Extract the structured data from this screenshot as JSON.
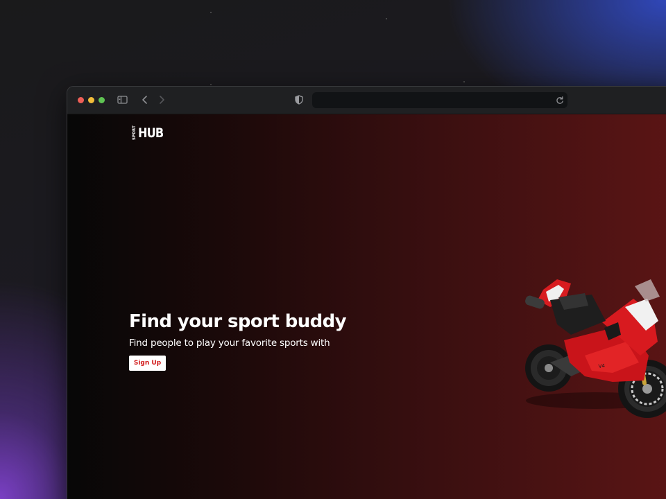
{
  "browser": {
    "address_value": ""
  },
  "site": {
    "logo_small": "SPORT",
    "logo_large": "HUB"
  },
  "hero": {
    "title": "Find your sport buddy",
    "subtitle": "Find people to play your favorite sports with",
    "cta_label": "Sign Up"
  },
  "icons": {
    "sidebar": "sidebar-icon",
    "back": "chevron-left-icon",
    "forward": "chevron-right-icon",
    "privacy": "shield-icon",
    "reload": "reload-icon",
    "hero_image": "motorcycle-image"
  },
  "colors": {
    "page_gradient_start": "#070707",
    "page_gradient_end": "#5b1515",
    "cta_text": "#d21b1b",
    "cta_background": "#ffffff",
    "desktop_blue": "#3047b8",
    "desktop_purple": "#7a3fc4"
  }
}
